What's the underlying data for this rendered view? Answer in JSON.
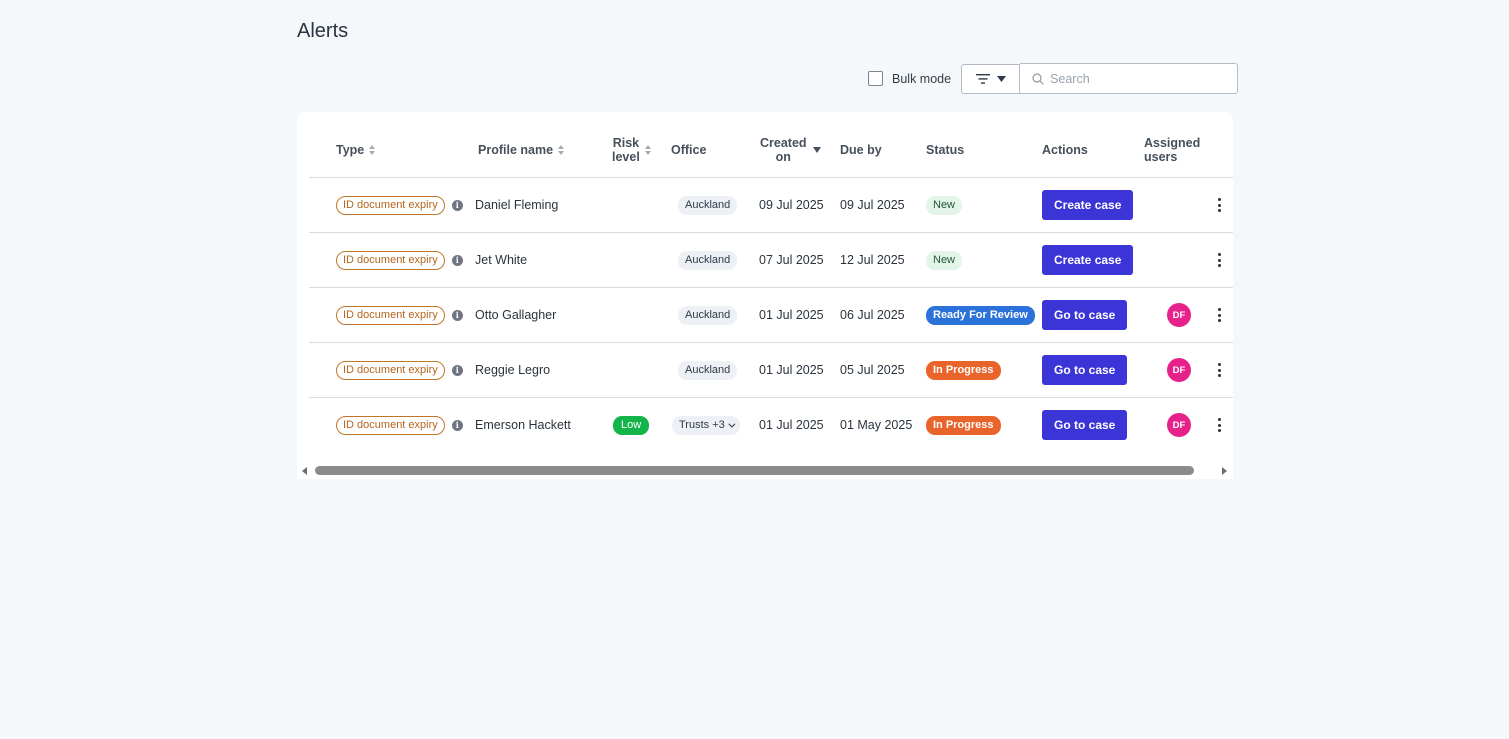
{
  "page": {
    "title": "Alerts"
  },
  "toolbar": {
    "bulk_mode_label": "Bulk mode",
    "search_placeholder": "Search"
  },
  "table": {
    "columns": {
      "type": "Type",
      "profile_name": "Profile name",
      "risk_level_1": "Risk",
      "risk_level_2": "level",
      "office": "Office",
      "created_on_1": "Created",
      "created_on_2": "on",
      "due_by": "Due by",
      "status": "Status",
      "actions": "Actions",
      "assigned_users_1": "Assigned",
      "assigned_users_2": "users"
    },
    "rows": [
      {
        "type": "ID document expiry",
        "name": "Daniel Fleming",
        "risk": "",
        "office": "Auckland",
        "created": "09 Jul 2025",
        "due": "09 Jul 2025",
        "status": "New",
        "action": "Create case",
        "assignee": ""
      },
      {
        "type": "ID document expiry",
        "name": "Jet White",
        "risk": "",
        "office": "Auckland",
        "created": "07 Jul 2025",
        "due": "12 Jul 2025",
        "status": "New",
        "action": "Create case",
        "assignee": ""
      },
      {
        "type": "ID document expiry",
        "name": "Otto Gallagher",
        "risk": "",
        "office": "Auckland",
        "created": "01 Jul 2025",
        "due": "06 Jul 2025",
        "status": "Ready For Review",
        "action": "Go to case",
        "assignee": "DF"
      },
      {
        "type": "ID document expiry",
        "name": "Reggie Legro",
        "risk": "",
        "office": "Auckland",
        "created": "01 Jul 2025",
        "due": "05 Jul 2025",
        "status": "In Progress",
        "action": "Go to case",
        "assignee": "DF"
      },
      {
        "type": "ID document expiry",
        "name": "Emerson Hackett",
        "risk": "Low",
        "office": "Trusts +3",
        "created": "01 Jul 2025",
        "due": "01 May 2025",
        "status": "In Progress",
        "action": "Go to case",
        "assignee": "DF"
      }
    ]
  },
  "colors": {
    "primary_button": "#3b35d8",
    "status_new_bg": "#e3f5e8",
    "status_review_bg": "#2a72d9",
    "status_progress_bg": "#e8642a",
    "risk_low_bg": "#13b54a",
    "avatar_bg": "#e6218a",
    "type_tag_border": "#c0762a"
  },
  "icons": {
    "filter": "filter-lines-icon",
    "search": "search-icon",
    "info": "info-icon",
    "more": "kebab-vertical-icon"
  }
}
